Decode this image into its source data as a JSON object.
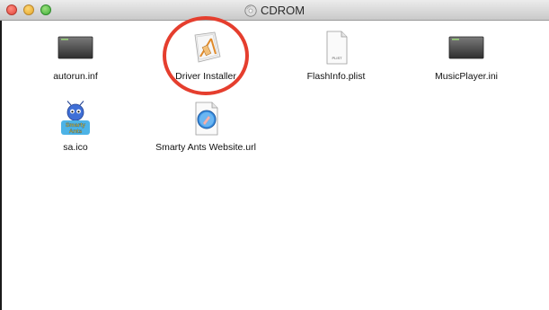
{
  "window": {
    "title": "CDROM",
    "title_icon": "cd-disc-icon"
  },
  "files": [
    {
      "name": "autorun.inf",
      "icon": "generic-file-icon"
    },
    {
      "name": "Driver Installer",
      "icon": "installer-package-icon"
    },
    {
      "name": "FlashInfo.plist",
      "icon": "plist-document-icon",
      "icon_text": "PLIST"
    },
    {
      "name": "MusicPlayer.ini",
      "icon": "generic-file-icon"
    },
    {
      "name": "sa.ico",
      "icon": "smarty-ants-logo-icon",
      "icon_text": "Smarty Ants"
    },
    {
      "name": "Smarty Ants Website.url",
      "icon": "safari-compass-icon"
    }
  ],
  "highlight": {
    "target": "Driver Installer",
    "color": "#e53e2e"
  }
}
